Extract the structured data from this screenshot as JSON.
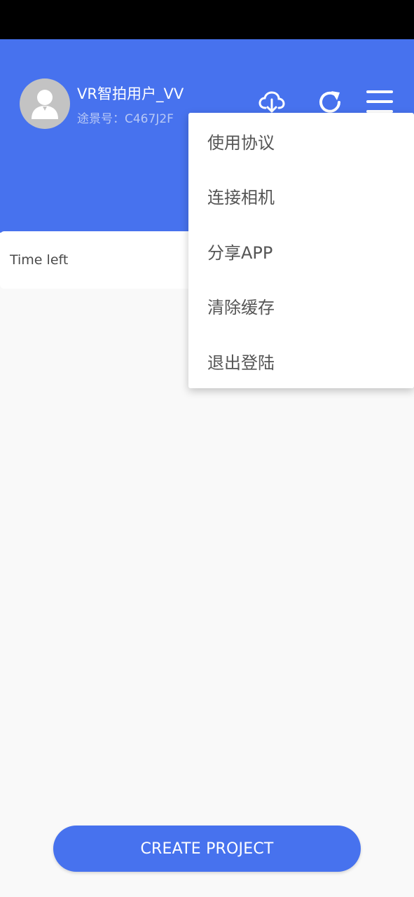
{
  "header": {
    "username": "VR智拍用户_VV",
    "account_id": "途景号：C467J2F",
    "avatar_icon": "user-avatar-icon",
    "download_icon": "cloud-download-icon",
    "refresh_icon": "refresh-icon",
    "menu_icon": "hamburger-menu-icon"
  },
  "card": {
    "time_left_label": "Time left"
  },
  "dropdown": {
    "items": [
      {
        "label": "使用协议"
      },
      {
        "label": "连接相机"
      },
      {
        "label": "分享APP"
      },
      {
        "label": "清除缓存"
      },
      {
        "label": "退出登陆"
      }
    ]
  },
  "footer": {
    "create_button_label": "CREATE PROJECT"
  },
  "colors": {
    "primary": "#4772ee",
    "background": "#f9f9f9",
    "status_bar": "#000000"
  }
}
